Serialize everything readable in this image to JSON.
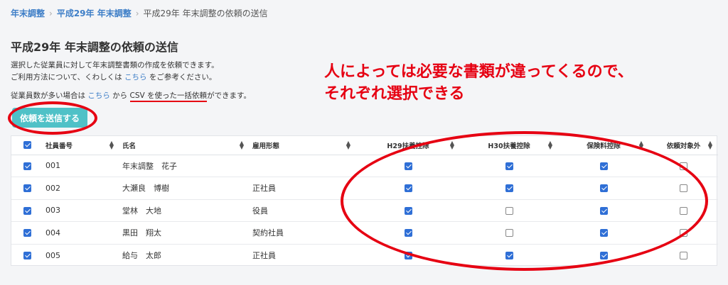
{
  "breadcrumb": {
    "items": [
      "年末調整",
      "平成29年 年末調整"
    ],
    "current": "平成29年 年末調整の依頼の送信"
  },
  "page": {
    "title": "平成29年 年末調整の依頼の送信",
    "desc1": "選択した従業員に対して年末調整書類の作成を依頼できます。",
    "desc2_pre": "ご利用方法について、くわしくは ",
    "desc2_link": "こちら",
    "desc2_post": " をご参考ください。",
    "desc3_pre": "従業員数が多い場合は ",
    "desc3_link": "こちら",
    "desc3_mid": " から ",
    "desc3_csv": "CSV を使った一括依頼",
    "desc3_post": "ができます。"
  },
  "annotation": {
    "line1": "人によっては必要な書類が違ってくるので、",
    "line2": "それぞれ選択できる"
  },
  "send_button": "依頼を送信する",
  "table": {
    "headers": {
      "emp_no": "社員番号",
      "name": "氏名",
      "employment": "雇用形態",
      "h29": "H29扶養控除",
      "h30": "H30扶養控除",
      "insurance": "保険料控除",
      "exclude": "依頼対象外"
    },
    "rows": [
      {
        "no": "001",
        "name": "年末調整　花子",
        "type": "",
        "h29": true,
        "h30": true,
        "ins": true,
        "ex": false
      },
      {
        "no": "002",
        "name": "大瀬良　博樹",
        "type": "正社員",
        "h29": true,
        "h30": true,
        "ins": true,
        "ex": false
      },
      {
        "no": "003",
        "name": "堂林　大地",
        "type": "役員",
        "h29": true,
        "h30": false,
        "ins": true,
        "ex": false
      },
      {
        "no": "004",
        "name": "黒田　翔太",
        "type": "契約社員",
        "h29": true,
        "h30": false,
        "ins": true,
        "ex": false
      },
      {
        "no": "005",
        "name": "給与　太郎",
        "type": "正社員",
        "h29": true,
        "h30": true,
        "ins": true,
        "ex": false
      }
    ]
  },
  "colors": {
    "accent": "#4fc1c7",
    "link": "#3d7ec7",
    "annotation": "#e60012",
    "checkbox": "#2f6fd6"
  }
}
